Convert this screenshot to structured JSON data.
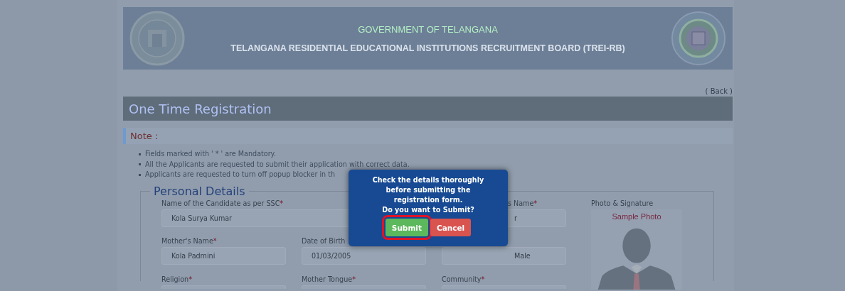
{
  "header": {
    "title": "GOVERNMENT OF TELANGANA",
    "subtitle": "TELANGANA RESIDENTIAL EDUCATIONAL INSTITUTIONS RECRUITMENT BOARD (TREI-RB)"
  },
  "back_link": "( Back )",
  "page_title": "One Time Registration",
  "note": {
    "heading": "Note :",
    "items": [
      "Fields marked with ' * ' are Mandatory.",
      "All the Applicants are requested to submit their application with correct data.",
      "Applicants are requested to turn off popup blocker in th"
    ]
  },
  "personal_details": {
    "legend": "Personal Details",
    "fields": [
      {
        "kind": "wide",
        "label": "Name of the Candidate as per SSC",
        "mark": "*",
        "value": "Kola Surya Kumar"
      },
      {
        "kind": "clipped",
        "label": "s Name",
        "mark": "*",
        "value": "r"
      },
      {
        "kind": "single",
        "label": "Mother's Name",
        "mark": "*",
        "value": "Kola Padmini"
      },
      {
        "kind": "single",
        "label": "Date of Birth",
        "value": "01/03/2005"
      },
      {
        "kind": "clipped",
        "value": "Male"
      },
      {
        "kind": "single",
        "label": "Religion",
        "mark": "*"
      },
      {
        "kind": "single",
        "label": "Mother Tongue",
        "mark": "*"
      },
      {
        "kind": "single",
        "label": "Community",
        "mark": "*"
      }
    ],
    "photo": {
      "label": "Photo & Signature",
      "caption": "Sample Photo"
    }
  },
  "dialog": {
    "lines": [
      "Check the details thoroughly before submitting the registration form.",
      "Do you want to Submit?"
    ],
    "buttons": [
      {
        "label": "Submit",
        "kind": "confirm",
        "highlighted": true
      },
      {
        "label": "Cancel",
        "kind": "cancel",
        "highlighted": false
      }
    ]
  }
}
